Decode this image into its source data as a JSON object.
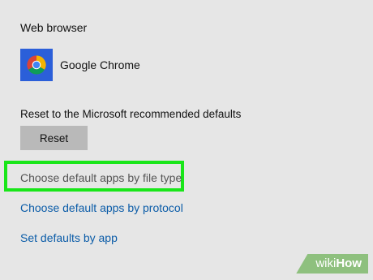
{
  "settings": {
    "web_browser_heading": "Web browser",
    "browser_name": "Google Chrome",
    "browser_icon": "chrome-icon",
    "reset_label": "Reset to the Microsoft recommended defaults",
    "reset_button": "Reset",
    "links": {
      "file_type": "Choose default apps by file type",
      "protocol": "Choose default apps by protocol",
      "by_app": "Set defaults by app"
    }
  },
  "highlight_color": "#19e619",
  "link_color": "#0b5ca8",
  "watermark": {
    "part1": "wiki",
    "part2": "How"
  }
}
